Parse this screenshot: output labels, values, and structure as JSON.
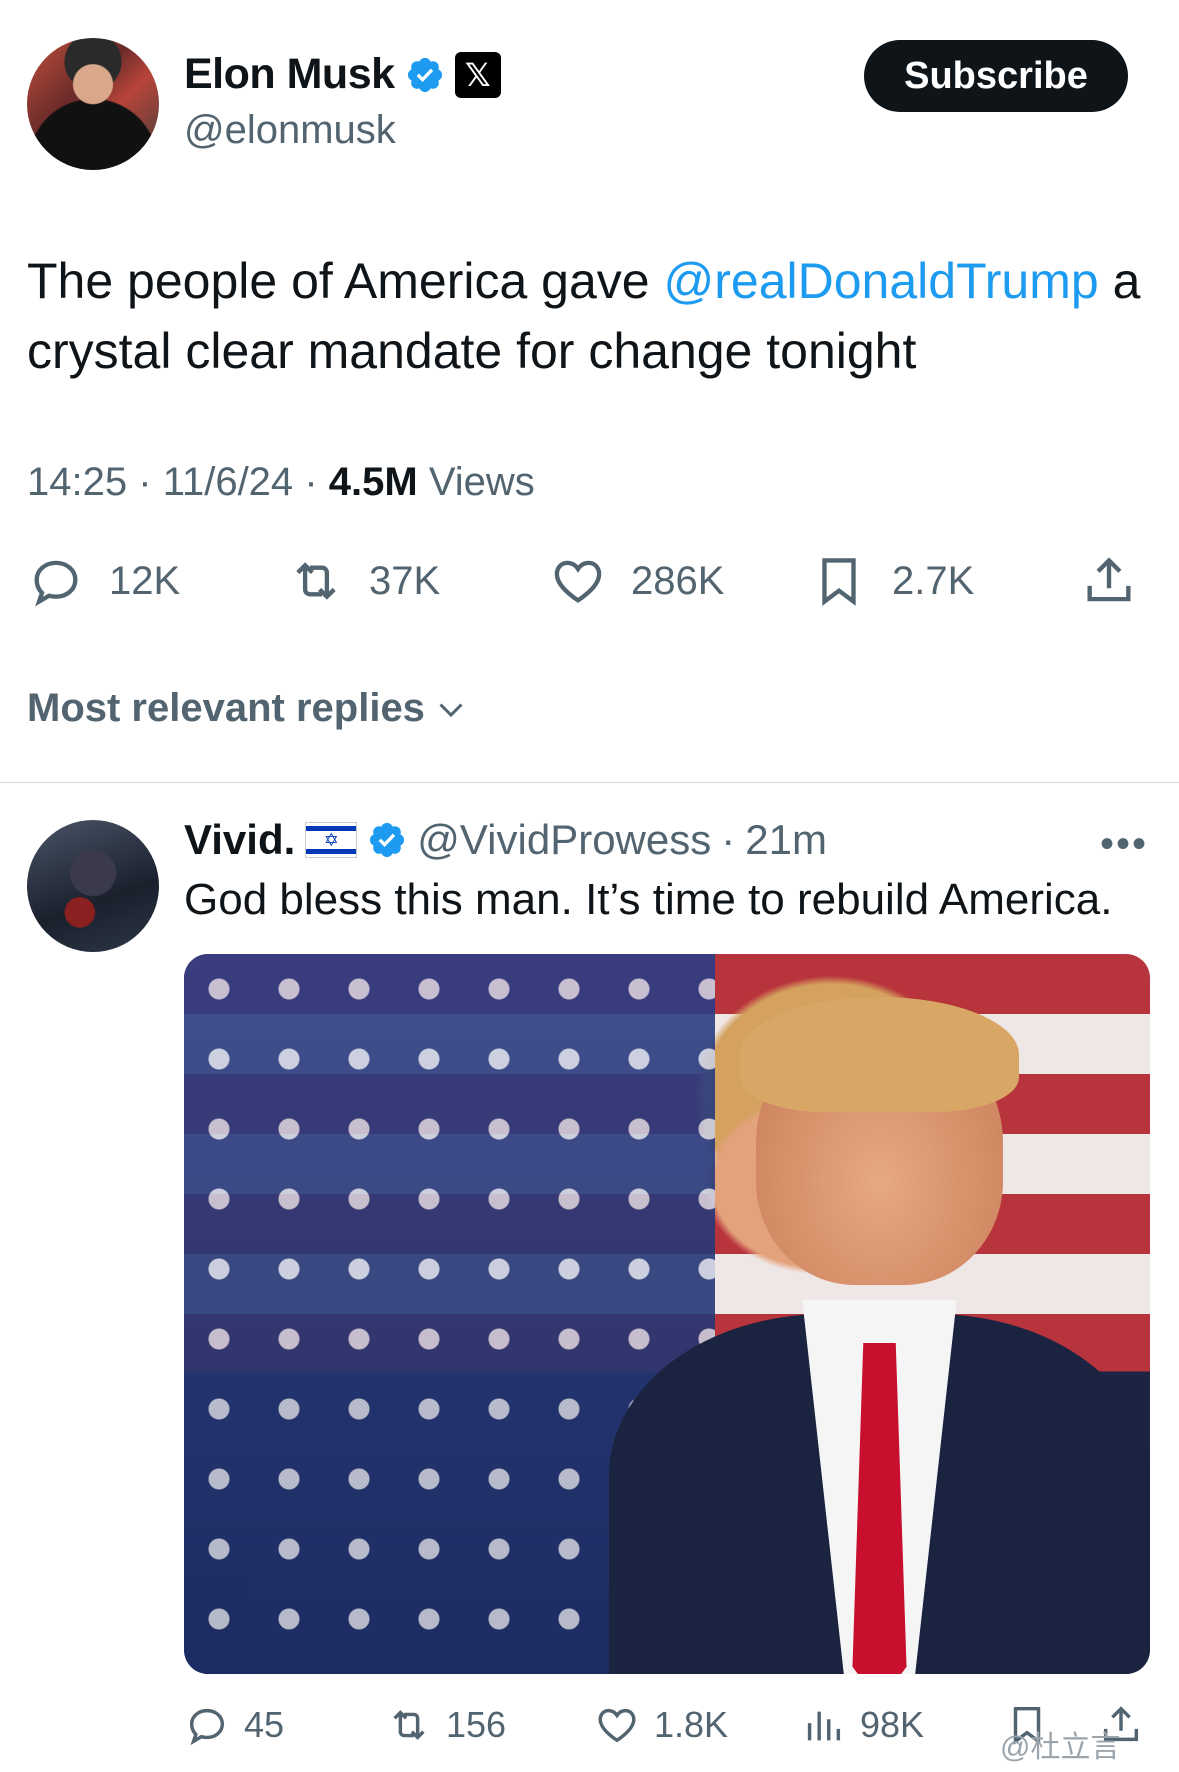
{
  "author": {
    "name": "Elon Musk",
    "handle": "@elonmusk",
    "x_badge": "𝕏"
  },
  "subscribe_label": "Subscribe",
  "tweet": {
    "text_before": "The people of America gave ",
    "mention": "@realDonaldTrump",
    "text_after": " a crystal clear mandate for change tonight",
    "time": "14:25",
    "date": "11/6/24",
    "separator": "·",
    "views_count": "4.5M",
    "views_label": "Views"
  },
  "actions": {
    "replies": "12K",
    "reposts": "37K",
    "likes": "286K",
    "bookmarks": "2.7K"
  },
  "replies_header": "Most relevant replies",
  "reply": {
    "name": "Vivid.",
    "handle": "@VividProwess",
    "time": "21m",
    "separator": "·",
    "more": "•••",
    "text": "God bless this man. It’s time to rebuild America.",
    "actions": {
      "replies": "45",
      "reposts": "156",
      "likes": "1.8K",
      "views": "98K"
    }
  },
  "watermark": "@杜立言",
  "colors": {
    "accent": "#1d9bf0",
    "text": "#0f1419",
    "secondary": "#536471"
  }
}
